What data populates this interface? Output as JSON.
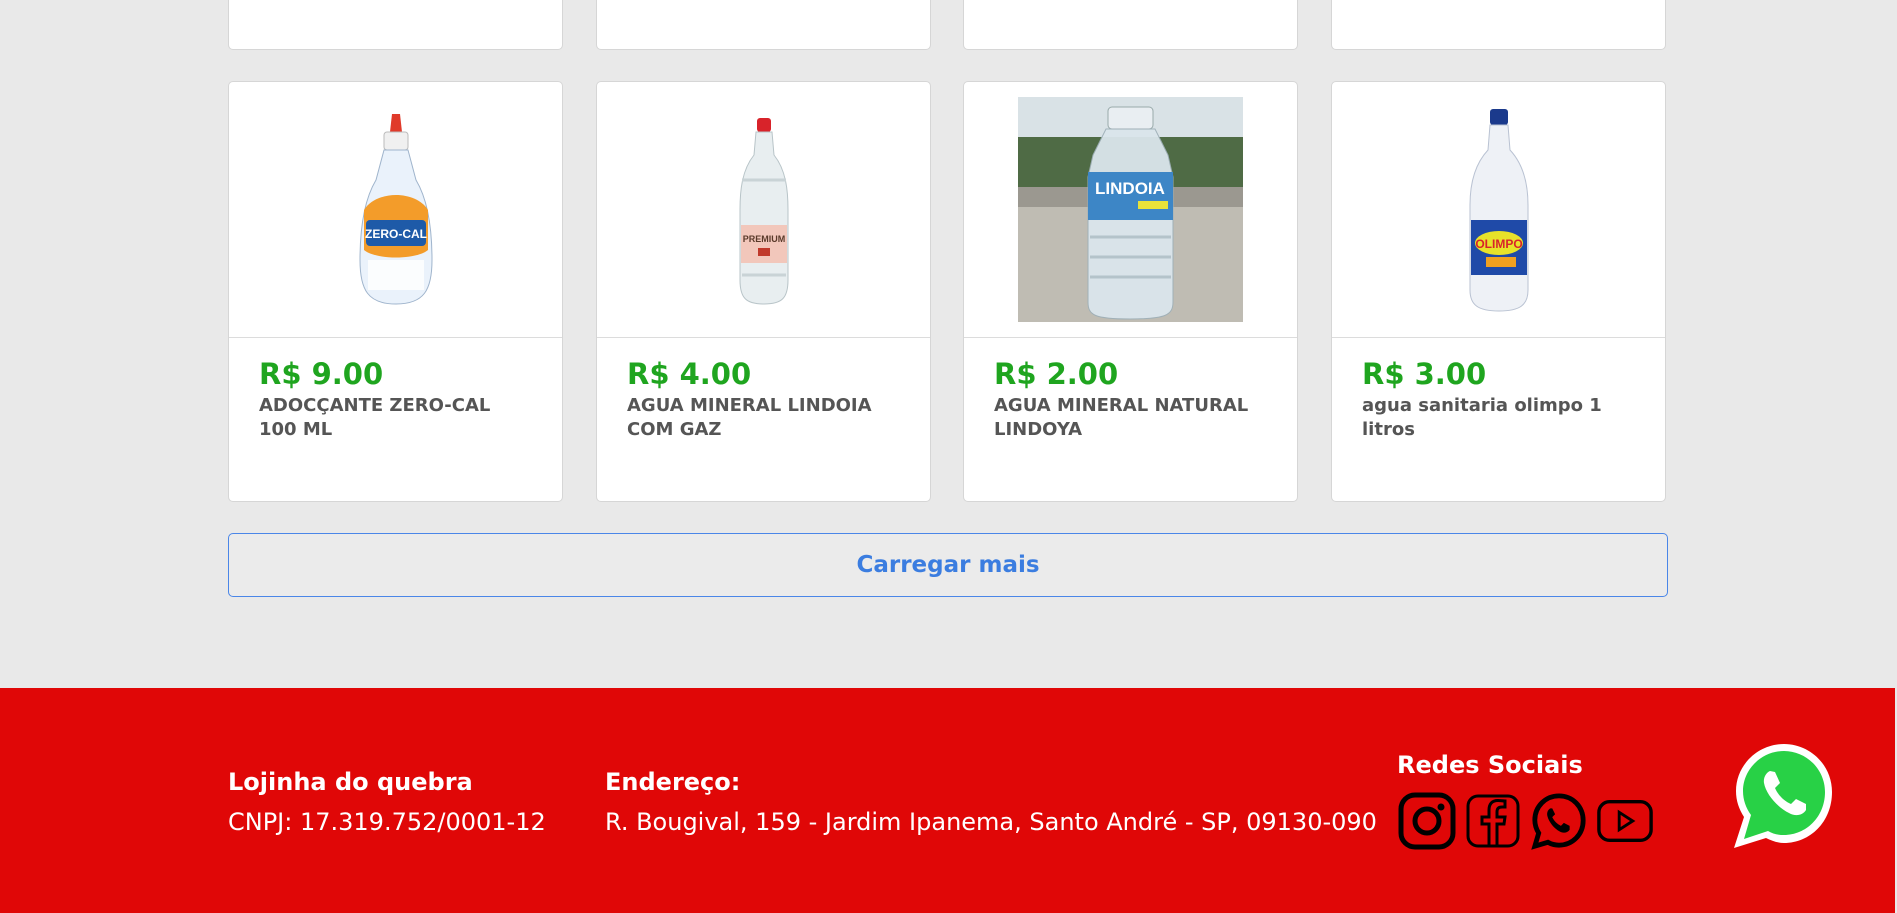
{
  "products": [
    {
      "price": "R$ 9.00",
      "name": "ADOCÇANTE ZERO-CAL 100 ML",
      "image": "zero-cal-bottle"
    },
    {
      "price": "R$ 4.00",
      "name": "AGUA MINERAL LINDOIA COM GAZ",
      "image": "sparkling-water-bottle"
    },
    {
      "price": "R$ 2.00",
      "name": "AGUA MINERAL NATURAL LINDOYA",
      "image": "lindoia-water-bottle-photo"
    },
    {
      "price": "R$ 3.00",
      "name": "agua sanitaria olimpo 1 litros",
      "image": "olimpo-bleach-bottle"
    }
  ],
  "labels": {
    "zero_cal": "ZERO-CAL",
    "premium": "PREMIUM",
    "lindoia": "LINDOIA",
    "olimpo": "OLIMPO"
  },
  "load_more_label": "Carregar mais",
  "footer": {
    "store_name": "Lojinha do quebra",
    "cnpj": "CNPJ: 17.319.752/0001-12",
    "address_title": "Endereço:",
    "address": "R. Bougival, 159 - Jardim Ipanema, Santo André - SP, 09130-090",
    "social_title": "Redes Sociais",
    "social_icons": [
      "instagram-icon",
      "facebook-icon",
      "whatsapp-icon",
      "youtube-icon"
    ]
  },
  "colors": {
    "price": "#1fa51f",
    "footer_bg": "#e00707",
    "load_more": "#3b7de0",
    "whatsapp": "#25d366"
  }
}
